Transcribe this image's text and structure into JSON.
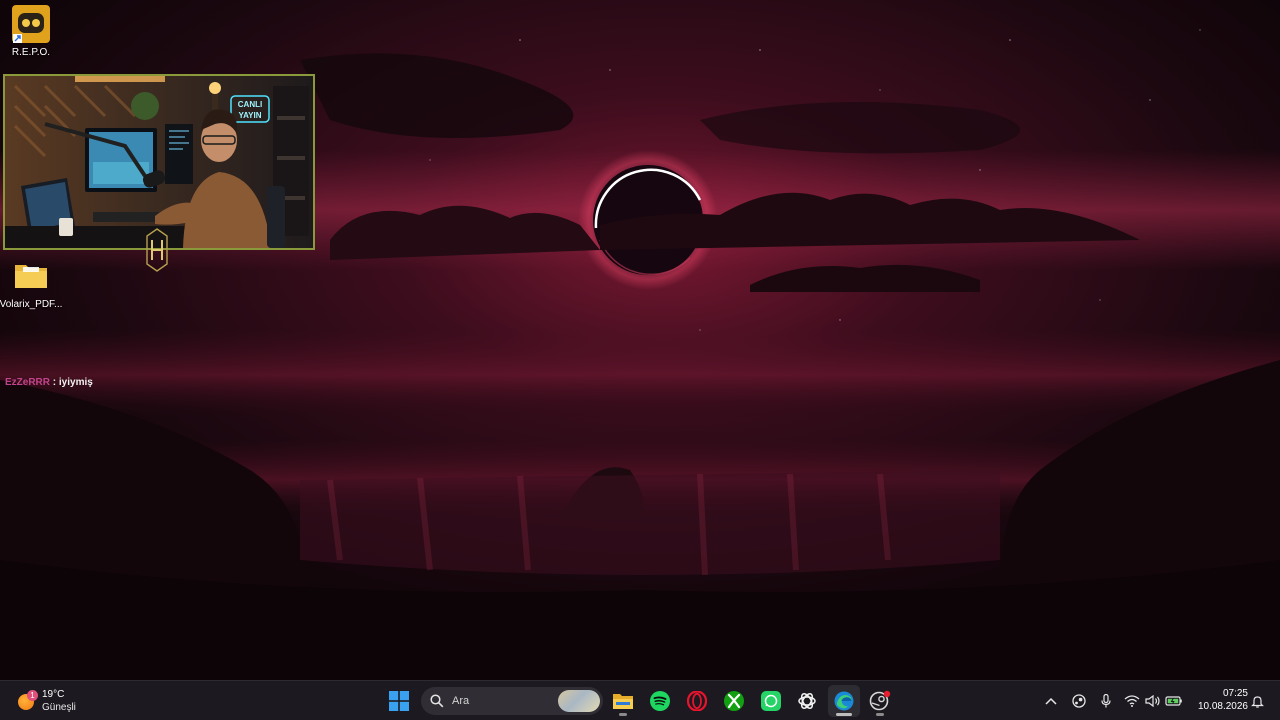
{
  "desktop": {
    "icons": [
      {
        "label": "R.E.P.O.",
        "icon": "repo-game-icon"
      },
      {
        "label": "Volarix_PDF...",
        "icon": "folder-icon"
      }
    ]
  },
  "webcam_overlay": {
    "sign_text_1": "CANLI",
    "sign_text_2": "YAYIN"
  },
  "chat": {
    "user": "EzZeRRR",
    "separator": " : ",
    "message": "iyiymiş"
  },
  "taskbar": {
    "weather": {
      "temp": "19°C",
      "condition": "Güneşli",
      "badge": "1"
    },
    "search_placeholder": "Ara",
    "apps": [
      {
        "name": "start",
        "icon": "windows-start-icon"
      },
      {
        "name": "file-explorer",
        "icon": "folder-icon"
      },
      {
        "name": "spotify",
        "icon": "spotify-icon"
      },
      {
        "name": "opera",
        "icon": "opera-icon"
      },
      {
        "name": "xbox",
        "icon": "xbox-icon"
      },
      {
        "name": "whatsapp",
        "icon": "whatsapp-icon"
      },
      {
        "name": "chatgpt",
        "icon": "chatgpt-icon"
      },
      {
        "name": "edge",
        "icon": "edge-icon"
      },
      {
        "name": "steam",
        "icon": "steam-icon"
      }
    ],
    "tray_icons": [
      "chevron-up-icon",
      "steam-tray-icon",
      "microphone-icon",
      "wifi-icon",
      "volume-icon",
      "battery-icon"
    ],
    "clock": {
      "time": "07:25",
      "date": "10.08.2026"
    }
  },
  "colors": {
    "taskbar_bg": "#1c1a20",
    "wallpaper_accent": "#8c1e3c",
    "chat_user": "#c0448a",
    "webcam_border": "#8a9a3a"
  }
}
